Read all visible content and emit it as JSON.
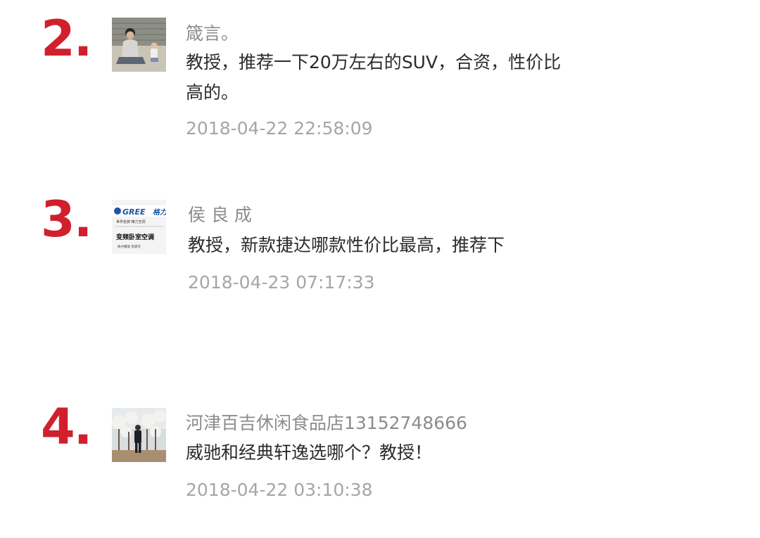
{
  "comments": [
    {
      "rank": "2.",
      "name": "箴言。",
      "text": "教授，推荐一下20万左右的SUV，合资，性价比高的。",
      "time": "2018-04-22 22:58:09",
      "avatar_icon": "person-with-child-photo"
    },
    {
      "rank": "3.",
      "name": "侯 良 成",
      "text": "教授，新款捷达哪款性价比最高，推荐下",
      "time": "2018-04-23 07:17:33",
      "avatar_icon": "gree-logo-avatar",
      "avatar_text": {
        "brand": "GREE",
        "tagline": "世界名牌  精力空调",
        "slogan": "变频卧室空调",
        "bottom": "依兴播放  优驭点"
      }
    },
    {
      "rank": "4.",
      "name": "河津百吉休闲食品店13152748666",
      "text": "威驰和经典轩逸选哪个？教授！",
      "time": "2018-04-22 03:10:38",
      "avatar_icon": "person-in-orchard-photo"
    }
  ],
  "colors": {
    "rank": "#d0202e",
    "name": "#8c8c8c",
    "text": "#2b2b2b",
    "time": "#a6a6a6"
  }
}
